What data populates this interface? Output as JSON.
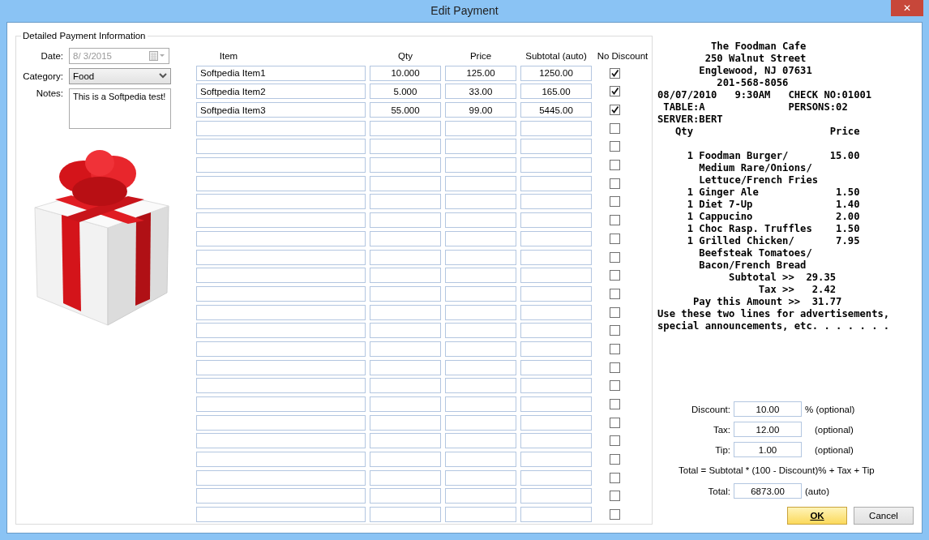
{
  "window": {
    "title": "Edit Payment",
    "close_label": "✕"
  },
  "group_title": "Detailed Payment Information",
  "date": {
    "label": "Date:",
    "value": "8/  3/2015",
    "disabled": true
  },
  "category": {
    "label": "Category:",
    "value": "Food"
  },
  "notes": {
    "label": "Notes:",
    "value": "This is a Softpedia test!"
  },
  "table": {
    "columns": [
      "Item",
      "Qty",
      "Price",
      "Subtotal (auto)",
      "No Discount"
    ],
    "rows": [
      {
        "item": "Softpedia Item1",
        "qty": "10.000",
        "price": "125.00",
        "subtotal": "1250.00",
        "no_discount": true
      },
      {
        "item": "Softpedia Item2",
        "qty": "5.000",
        "price": "33.00",
        "subtotal": "165.00",
        "no_discount": true
      },
      {
        "item": "Softpedia Item3",
        "qty": "55.000",
        "price": "99.00",
        "subtotal": "5445.00",
        "no_discount": true
      },
      {
        "no_discount": false
      },
      {
        "no_discount": false
      },
      {
        "no_discount": false
      },
      {
        "no_discount": false
      },
      {
        "no_discount": false
      },
      {
        "no_discount": false
      },
      {
        "no_discount": false
      },
      {
        "no_discount": false
      },
      {
        "no_discount": false
      },
      {
        "no_discount": false
      },
      {
        "no_discount": false
      },
      {
        "no_discount": false
      },
      {
        "no_discount": false
      },
      {
        "no_discount": false
      },
      {
        "no_discount": false
      },
      {
        "no_discount": false
      },
      {
        "no_discount": false
      },
      {
        "no_discount": false
      },
      {
        "no_discount": false
      },
      {
        "no_discount": false
      },
      {
        "no_discount": false
      },
      {
        "no_discount": false
      }
    ]
  },
  "receipt": [
    [
      "         The Foodman Cafe",
      "        250 Walnut Street",
      "       Englewood, NJ 07631",
      "          201-568-8056",
      "08/07/2010   9:30AM   CHECK NO:01001",
      " TABLE:A              PERSONS:02",
      "SERVER:BERT",
      "   Qty                       Price"
    ],
    [
      "     1 Foodman Burger/       15.00",
      "       Medium Rare/Onions/",
      "       Lettuce/French Fries",
      "     1 Ginger Ale             1.50",
      "     1 Diet 7-Up              1.40",
      "     1 Cappucino              2.00",
      "     1 Choc Rasp. Truffles    1.50",
      "     1 Grilled Chicken/       7.95",
      "       Beefsteak Tomatoes/",
      "       Bacon/French Bread",
      "            Subtotal >>  29.35",
      "                 Tax >>   2.42",
      "      Pay this Amount >>  31.77",
      "Use these two lines for advertisements,",
      "special announcements, etc. . . . . . ."
    ]
  ],
  "summary": [
    {
      "label": "Discount:",
      "value": "10.00",
      "hint": "% (optional)"
    },
    {
      "label": "Tax:",
      "value": "12.00",
      "hint": "(optional)"
    },
    {
      "label": "Tip:",
      "value": "1.00",
      "hint": "(optional)"
    }
  ],
  "formula": "Total = Subtotal * (100 - Discount)% + Tax + Tip",
  "total": {
    "label": "Total:",
    "value": "6873.00",
    "hint": "(auto)"
  },
  "buttons": [
    {
      "label": "OK",
      "kind": "default"
    },
    {
      "label": "Cancel",
      "kind": "normal"
    }
  ]
}
